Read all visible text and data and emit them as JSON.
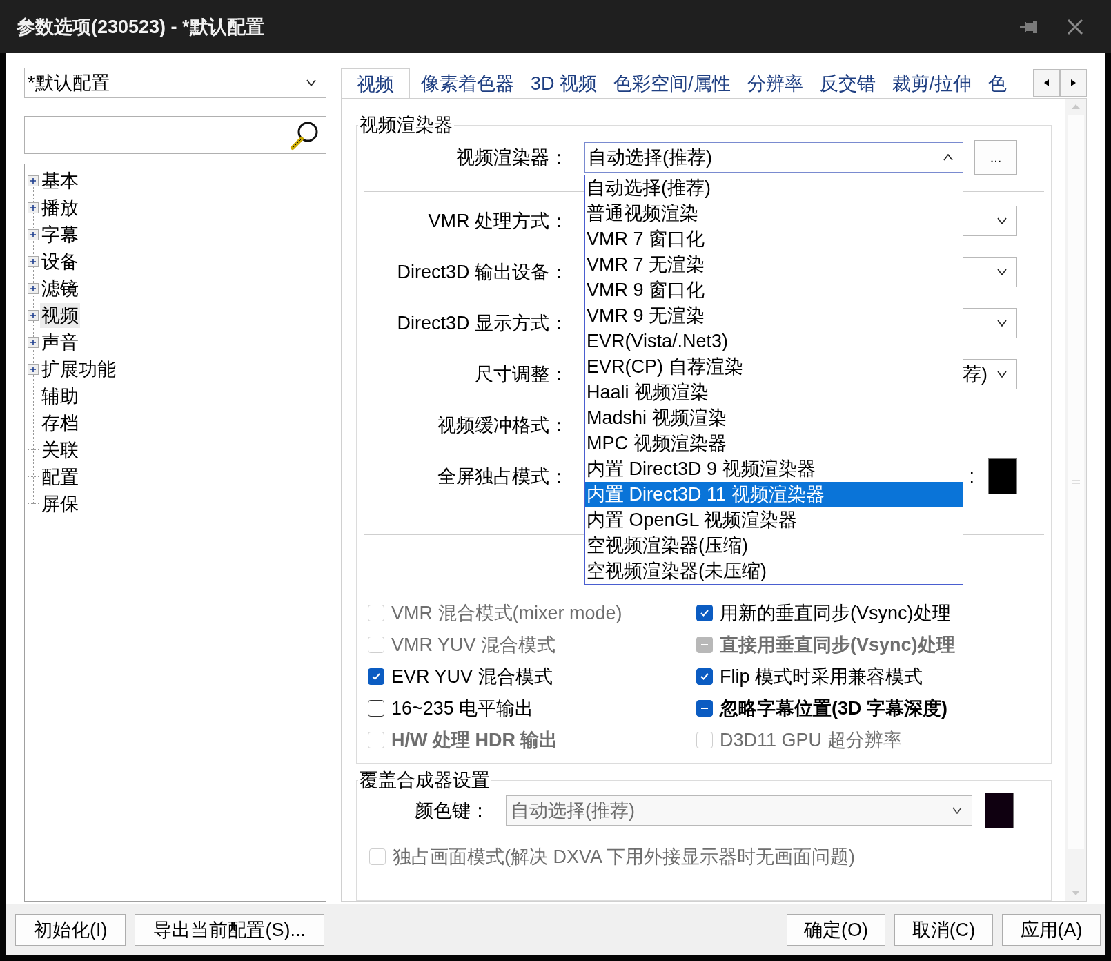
{
  "window": {
    "title": "参数选项(230523) - *默认配置"
  },
  "profile": {
    "value": "*默认配置"
  },
  "tree": [
    {
      "label": "基本",
      "expandable": true,
      "selected": false
    },
    {
      "label": "播放",
      "expandable": true,
      "selected": false
    },
    {
      "label": "字幕",
      "expandable": true,
      "selected": false
    },
    {
      "label": "设备",
      "expandable": true,
      "selected": false
    },
    {
      "label": "滤镜",
      "expandable": true,
      "selected": false
    },
    {
      "label": "视频",
      "expandable": true,
      "selected": true
    },
    {
      "label": "声音",
      "expandable": true,
      "selected": false
    },
    {
      "label": "扩展功能",
      "expandable": true,
      "selected": false
    },
    {
      "label": "辅助",
      "expandable": false,
      "selected": false
    },
    {
      "label": "存档",
      "expandable": false,
      "selected": false
    },
    {
      "label": "关联",
      "expandable": false,
      "selected": false
    },
    {
      "label": "配置",
      "expandable": false,
      "selected": false
    },
    {
      "label": "屏保",
      "expandable": false,
      "selected": false
    }
  ],
  "tabs": [
    {
      "label": "视频",
      "selected": true
    },
    {
      "label": "像素着色器",
      "selected": false
    },
    {
      "label": "3D 视频",
      "selected": false
    },
    {
      "label": "色彩空间/属性",
      "selected": false
    },
    {
      "label": "分辨率",
      "selected": false
    },
    {
      "label": "反交错",
      "selected": false
    },
    {
      "label": "裁剪/拉伸",
      "selected": false
    },
    {
      "label": "色",
      "selected": false
    }
  ],
  "renderer_group": {
    "title": "视频渲染器",
    "renderer": {
      "label": "视频渲染器：",
      "value": "自动选择(推荐)",
      "expanded": true,
      "button": "..."
    },
    "rows": [
      {
        "label": "VMR 处理方式：",
        "kind": "combo"
      },
      {
        "label": "Direct3D 输出设备：",
        "kind": "combo"
      },
      {
        "label": "Direct3D 显示方式：",
        "kind": "combo"
      },
      {
        "label": "尺寸调整：",
        "kind": "combo",
        "value": "荐)"
      },
      {
        "label": "视频缓冲格式：",
        "kind": "blank"
      },
      {
        "label": "全屏独占模式：",
        "kind": "swatch",
        "side_label": ":"
      }
    ],
    "options_left": [
      {
        "label": "VMR 混合模式(mixer mode)",
        "checked": false,
        "indeterminate": false,
        "disabled": true,
        "bold": false
      },
      {
        "label": "VMR YUV 混合模式",
        "checked": false,
        "indeterminate": false,
        "disabled": true,
        "bold": false
      },
      {
        "label": "EVR YUV 混合模式",
        "checked": true,
        "indeterminate": false,
        "disabled": false,
        "bold": false
      },
      {
        "label": "16~235 电平输出",
        "checked": false,
        "indeterminate": false,
        "disabled": false,
        "bold": false
      },
      {
        "label": "H/W 处理 HDR 输出",
        "checked": false,
        "indeterminate": false,
        "disabled": true,
        "bold": true
      }
    ],
    "options_right": [
      {
        "label": "用新的垂直同步(Vsync)处理",
        "checked": true,
        "indeterminate": false,
        "disabled": false,
        "bold": false
      },
      {
        "label": "直接用垂直同步(Vsync)处理",
        "checked": true,
        "indeterminate": true,
        "disabled": true,
        "bold": true
      },
      {
        "label": "Flip 模式时采用兼容模式",
        "checked": true,
        "indeterminate": false,
        "disabled": false,
        "bold": false
      },
      {
        "label": "忽略字幕位置(3D 字幕深度)",
        "checked": true,
        "indeterminate": true,
        "disabled": false,
        "bold": true
      },
      {
        "label": "D3D11 GPU 超分辨率",
        "checked": false,
        "indeterminate": false,
        "disabled": true,
        "bold": false
      }
    ]
  },
  "renderer_list": [
    {
      "label": "自动选择(推荐)",
      "selected": false
    },
    {
      "label": "普通视频渲染",
      "selected": false
    },
    {
      "label": "VMR 7 窗口化",
      "selected": false
    },
    {
      "label": "VMR 7 无渲染",
      "selected": false
    },
    {
      "label": "VMR 9 窗口化",
      "selected": false
    },
    {
      "label": "VMR 9 无渲染",
      "selected": false
    },
    {
      "label": "EVR(Vista/.Net3)",
      "selected": false
    },
    {
      "label": "EVR(CP) 自荐渲染",
      "selected": false
    },
    {
      "label": "Haali 视频渲染",
      "selected": false
    },
    {
      "label": "Madshi 视频渲染",
      "selected": false
    },
    {
      "label": "MPC 视频渲染器",
      "selected": false
    },
    {
      "label": "内置 Direct3D 9 视频渲染器",
      "selected": false
    },
    {
      "label": "内置 Direct3D 11 视频渲染器",
      "selected": true
    },
    {
      "label": "内置 OpenGL 视频渲染器",
      "selected": false
    },
    {
      "label": "空视频渲染器(压缩)",
      "selected": false
    },
    {
      "label": "空视频渲染器(未压缩)",
      "selected": false
    }
  ],
  "overlay_group": {
    "title": "覆盖合成器设置",
    "color_key": {
      "label": "颜色键：",
      "value": "自动选择(推荐)",
      "disabled": true
    },
    "exclusive": {
      "label": "独占画面模式(解决 DXVA 下用外接显示器时无画面问题)",
      "checked": false,
      "indeterminate": false,
      "disabled": true,
      "bold": false
    }
  },
  "buttons_left": [
    "初始化(I)",
    "导出当前配置(S)..."
  ],
  "buttons_right": [
    "确定(O)",
    "取消(C)",
    "应用(A)"
  ]
}
